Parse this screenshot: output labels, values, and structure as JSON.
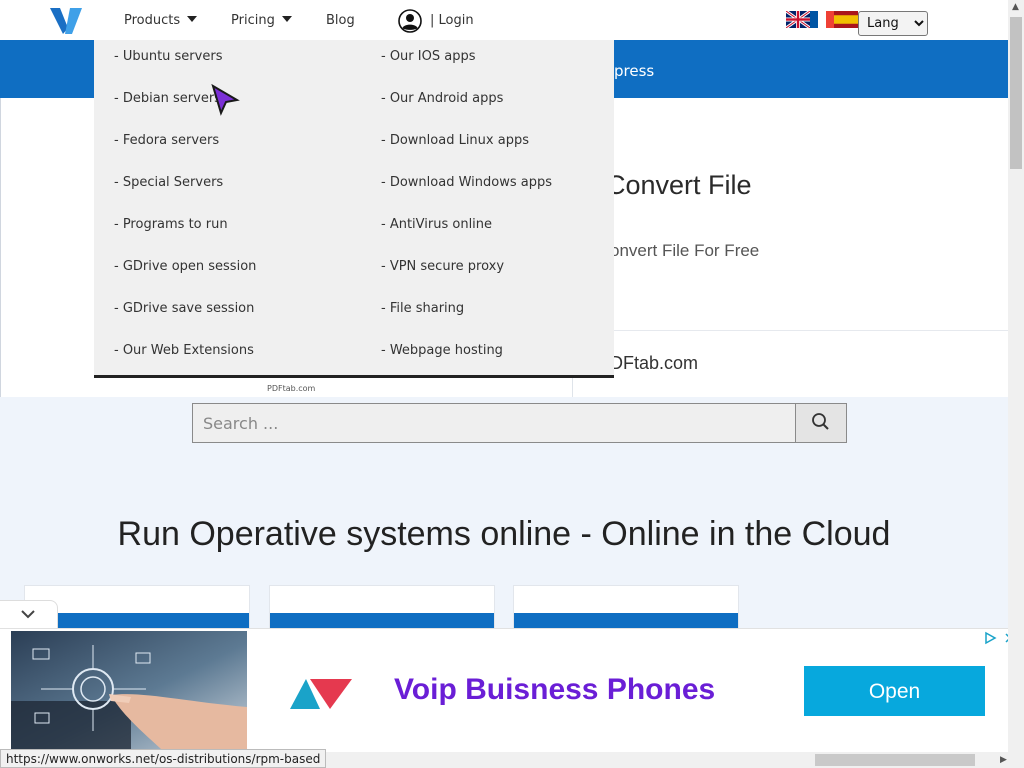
{
  "nav": {
    "products": "Products",
    "pricing": "Pricing",
    "blog": "Blog",
    "login": "| Login",
    "lang": "Lang"
  },
  "dropdown": {
    "left": [
      "- Ubuntu servers",
      "- Debian servers",
      "- Fedora servers",
      "- Special Servers",
      "- Programs to run",
      "- GDrive open session",
      "- GDrive save session",
      "- Our Web Extensions"
    ],
    "right": [
      "- Our IOS apps",
      "- Our Android apps",
      "- Download Linux apps",
      "- Download Windows apps",
      "- AntiVirus online",
      "- VPN secure proxy",
      "- File sharing",
      "- Webpage hosting"
    ]
  },
  "band": {
    "text": "press"
  },
  "hero": {
    "title": "Convert File",
    "subtitle": "onvert File For Free",
    "site": "DFtab.com",
    "small": "PDFtab.com"
  },
  "search": {
    "placeholder": "Search ..."
  },
  "section": {
    "title": "Run Operative systems online - Online in the Cloud"
  },
  "ad": {
    "headline": "Voip Buisness Phones",
    "button": "Open"
  },
  "status": {
    "url": "https://www.onworks.net/os-distributions/rpm-based"
  },
  "colors": {
    "brand_blue": "#0f6ec2",
    "ad_purple": "#6a1ed6",
    "ad_button": "#07a8dd"
  }
}
